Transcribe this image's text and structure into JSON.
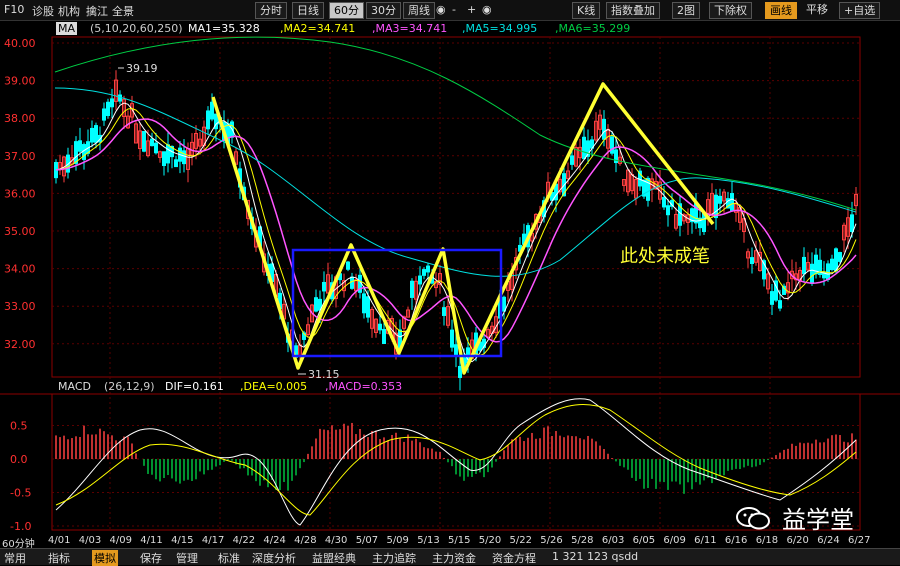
{
  "topbar": {
    "f10": "F10",
    "menu": [
      "诊股",
      "机构",
      "擒江",
      "全景"
    ],
    "ma_dropdown": "MA",
    "period_buttons": [
      "分时",
      "日线",
      "60分",
      "30分",
      "周线"
    ],
    "active_period": "60分",
    "minus": "-",
    "plus": "+",
    "kline": "K线",
    "index_overlay": "指数叠加",
    "two_charts": "2图",
    "ex_rights": "下除权",
    "draw_line": "画线",
    "pan": "平移",
    "self_select": "+自选"
  },
  "ma_legend": {
    "params": "(5,10,20,60,250)",
    "ma1": "MA1=35.328",
    "ma2": ",MA2=34.741",
    "ma3": ",MA3=34.741",
    "ma5": ",MA5=34.995",
    "ma6": ",MA6=35.299"
  },
  "macd_legend": {
    "label": "MACD",
    "params": "(26,12,9)",
    "dif": "DIF=0.161",
    "dea": ",DEA=0.005",
    "macd": ",MACD=0.353"
  },
  "price_axis": [
    "40.00",
    "39.00",
    "38.00",
    "37.00",
    "36.00",
    "35.00",
    "34.00",
    "33.00",
    "32.00"
  ],
  "macd_axis": [
    "0.5",
    "0.0",
    "-0.5",
    "-1.0"
  ],
  "annotations": {
    "high": "39.19",
    "low": "31.15",
    "note": "此处未成笔"
  },
  "x_labels": [
    "4/01",
    "4/03",
    "4/09",
    "4/11",
    "4/15",
    "4/17",
    "4/22",
    "4/24",
    "4/28",
    "4/30",
    "5/07",
    "5/09",
    "5/13",
    "5/15",
    "5/20",
    "5/22",
    "5/26",
    "5/28",
    "6/03",
    "6/05",
    "6/09",
    "6/11",
    "6/16",
    "6/18",
    "6/20",
    "6/24",
    "6/27"
  ],
  "period_label": "60分钟",
  "bottombar": {
    "items": [
      "常用",
      "指标",
      "模拟",
      "保存",
      "管理",
      "标准",
      "深度分析",
      "益盟经典",
      "主力追踪",
      "主力资金",
      "资金方程"
    ],
    "status": "1 321 123 qsdd"
  },
  "watermark": "益学堂",
  "colors": {
    "ma1": "#ffffff",
    "ma2": "#ffff00",
    "ma3": "#ff55ff",
    "ma5": "#00e0e0",
    "ma6": "#00cc44",
    "up": "#ff4040",
    "down": "#00ffff",
    "pen": "#ffff33",
    "box": "#1a1aff"
  }
}
